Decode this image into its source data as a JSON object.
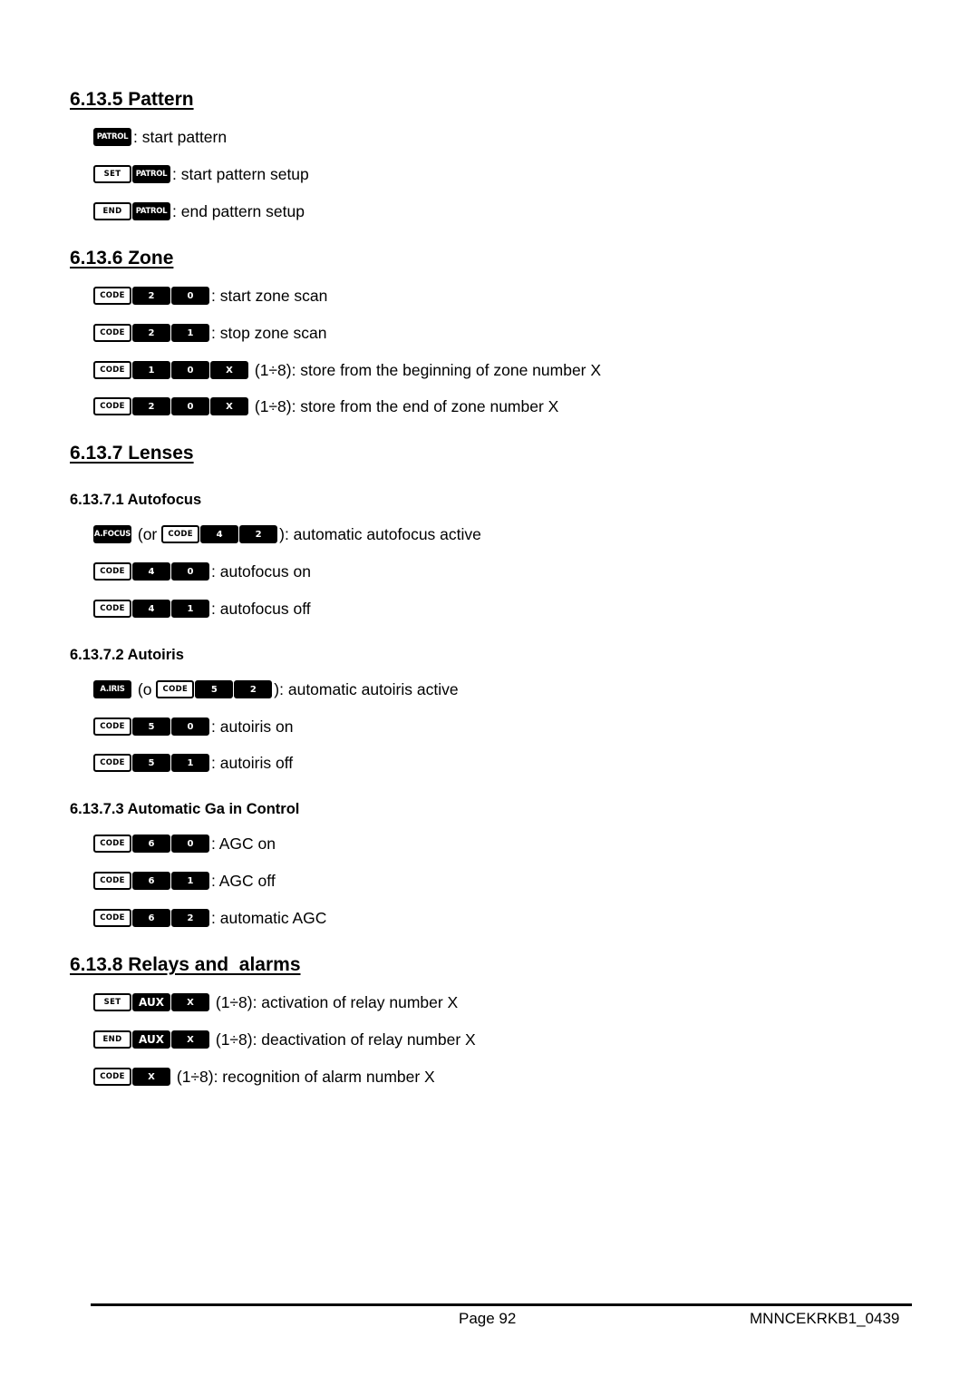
{
  "sections": {
    "pattern": {
      "title": "6.13.5 Pattern",
      "rows": [
        {
          "keys": [
            "PATROL"
          ],
          "text": ": start pattern"
        },
        {
          "keys": [
            "SET",
            "PATROL"
          ],
          "text": ": start pattern setup"
        },
        {
          "keys": [
            "END",
            "PATROL"
          ],
          "text": ": end pattern setup"
        }
      ]
    },
    "zone": {
      "title": "6.13.6 Zone",
      "rows": [
        {
          "keys": [
            "CODE",
            "2",
            "0"
          ],
          "text": ": start zone scan"
        },
        {
          "keys": [
            "CODE",
            "2",
            "1"
          ],
          "text": ": stop zone scan"
        },
        {
          "keys": [
            "CODE",
            "1",
            "0",
            "X"
          ],
          "text": " (1÷8): store from the beginning of zone number X"
        },
        {
          "keys": [
            "CODE",
            "2",
            "0",
            "X"
          ],
          "text": " (1÷8): store from the end of zone number X"
        }
      ]
    },
    "lenses": {
      "title": "6.13.7 Lenses",
      "autofocus": {
        "title": "6.13.7.1 Autofocus",
        "rows": [
          {
            "keys": [
              "A.FOCUS"
            ],
            "prefix": " (or ",
            "alt_keys": [
              "CODE",
              "4",
              "2"
            ],
            "text": "): automatic autofocus active"
          },
          {
            "keys": [
              "CODE",
              "4",
              "0"
            ],
            "text": ": autofocus on"
          },
          {
            "keys": [
              "CODE",
              "4",
              "1"
            ],
            "text": ": autofocus off"
          }
        ]
      },
      "autoiris": {
        "title": "6.13.7.2 Autoiris",
        "rows": [
          {
            "keys": [
              "A.IRIS"
            ],
            "prefix": " (o ",
            "alt_keys": [
              "CODE",
              "5",
              "2"
            ],
            "text": "): automatic autoiris active"
          },
          {
            "keys": [
              "CODE",
              "5",
              "0"
            ],
            "text": ": autoiris on"
          },
          {
            "keys": [
              "CODE",
              "5",
              "1"
            ],
            "text": ": autoiris off"
          }
        ]
      },
      "agc": {
        "title": "6.13.7.3 Automatic Ga in Control",
        "rows": [
          {
            "keys": [
              "CODE",
              "6",
              "0"
            ],
            "text": ": AGC on"
          },
          {
            "keys": [
              "CODE",
              "6",
              "1"
            ],
            "text": ": AGC off"
          },
          {
            "keys": [
              "CODE",
              "6",
              "2"
            ],
            "text": ": automatic AGC"
          }
        ]
      }
    },
    "relays": {
      "title": "6.13.8 Relays and  alarms",
      "rows": [
        {
          "keys": [
            "SET",
            "AUX",
            "X"
          ],
          "text": " (1÷8): activation of relay number X"
        },
        {
          "keys": [
            "END",
            "AUX",
            "X"
          ],
          "text": " (1÷8): deactivation of relay number X"
        },
        {
          "keys": [
            "CODE",
            "X"
          ],
          "text": " (1÷8): recognition of alarm number X"
        }
      ]
    }
  },
  "footer": {
    "page": "Page 92",
    "doc_code": "MNNCEKRKB1_0439"
  }
}
